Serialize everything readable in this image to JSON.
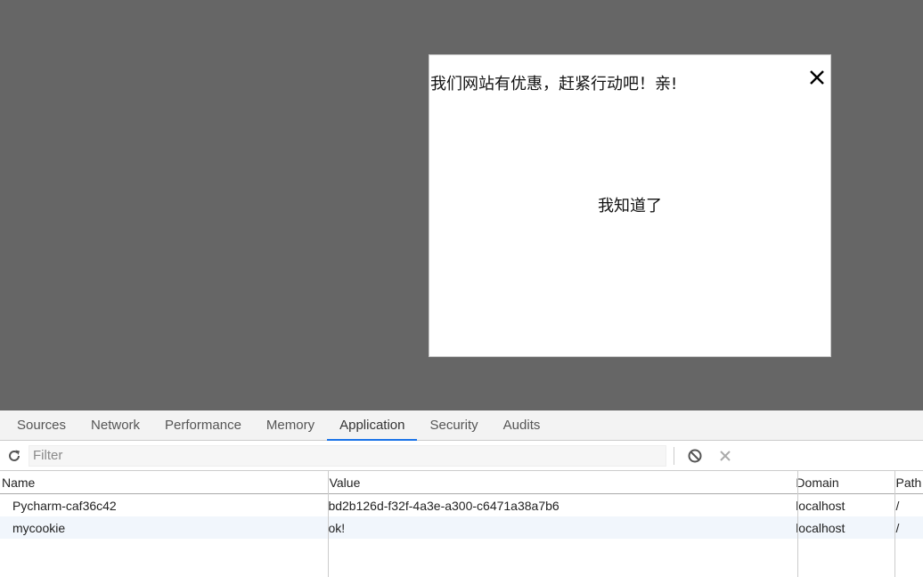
{
  "popup": {
    "message": "我们网站有优惠，赶紧行动吧！亲!",
    "ack_label": "我知道了",
    "close_icon": "close-icon"
  },
  "devtools": {
    "tabs": [
      {
        "label": "Sources"
      },
      {
        "label": "Network"
      },
      {
        "label": "Performance"
      },
      {
        "label": "Memory"
      },
      {
        "label": "Application",
        "active": true
      },
      {
        "label": "Security"
      },
      {
        "label": "Audits"
      }
    ],
    "toolbar": {
      "filter_placeholder": "Filter",
      "filter_value": "",
      "icons": [
        "refresh-icon",
        "clear-all-icon",
        "delete-selected-icon"
      ]
    },
    "cookies": {
      "columns": [
        "Name",
        "Value",
        "Domain",
        "Path"
      ],
      "rows": [
        {
          "name": "Pycharm-caf36c42",
          "value": "bd2b126d-f32f-4a3e-a300-c6471a38a7b6",
          "domain": "localhost",
          "path": "/"
        },
        {
          "name": "mycookie",
          "value": "ok!",
          "domain": "localhost",
          "path": "/"
        }
      ]
    }
  },
  "colors": {
    "overlay": "#666666",
    "popup_bg": "#ffffff",
    "active_tab_underline": "#1a73e8",
    "selected_row_bg": "#f1f6fc"
  }
}
